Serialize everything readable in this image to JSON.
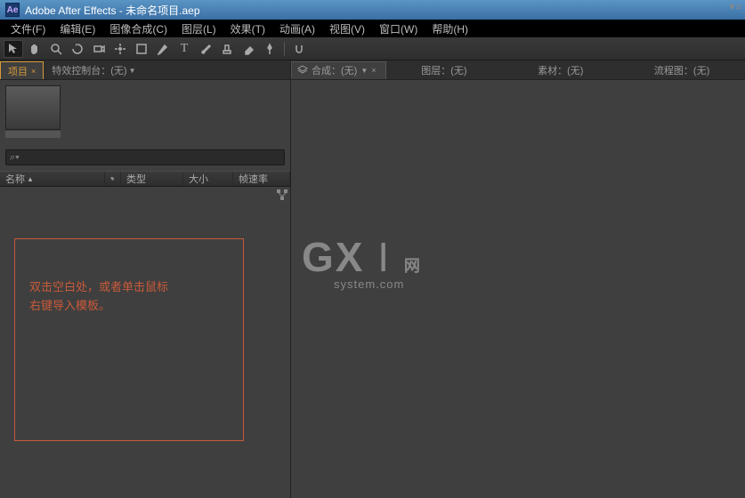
{
  "app": {
    "logo_text": "Ae",
    "title": "Adobe After Effects - 未命名项目.aep"
  },
  "menu": {
    "file": "文件(F)",
    "edit": "编辑(E)",
    "composition": "图像合成(C)",
    "layer": "图层(L)",
    "effect": "效果(T)",
    "animation": "动画(A)",
    "view": "视图(V)",
    "window": "窗口(W)",
    "help": "帮助(H)"
  },
  "left_tabs": {
    "project": "项目",
    "project_close": "×",
    "effect_controls": "特效控制台：(无)"
  },
  "search": {
    "icon": "⌕▾"
  },
  "columns": {
    "name": "名称",
    "type": "类型",
    "size": "大小",
    "rate": "帧速率",
    "sort": "▲"
  },
  "hint": {
    "line1": "双击空白处，或者单击鼠标",
    "line2": "右键导入模板。"
  },
  "viewer_tabs": {
    "composition": "合成：(无)",
    "layer": "图层：(无)",
    "footage": "素材：(无)",
    "flowchart": "流程图：(无)"
  },
  "watermark": {
    "main": "GX",
    "pipe": "I",
    "net": "网",
    "sub": "system.com"
  }
}
